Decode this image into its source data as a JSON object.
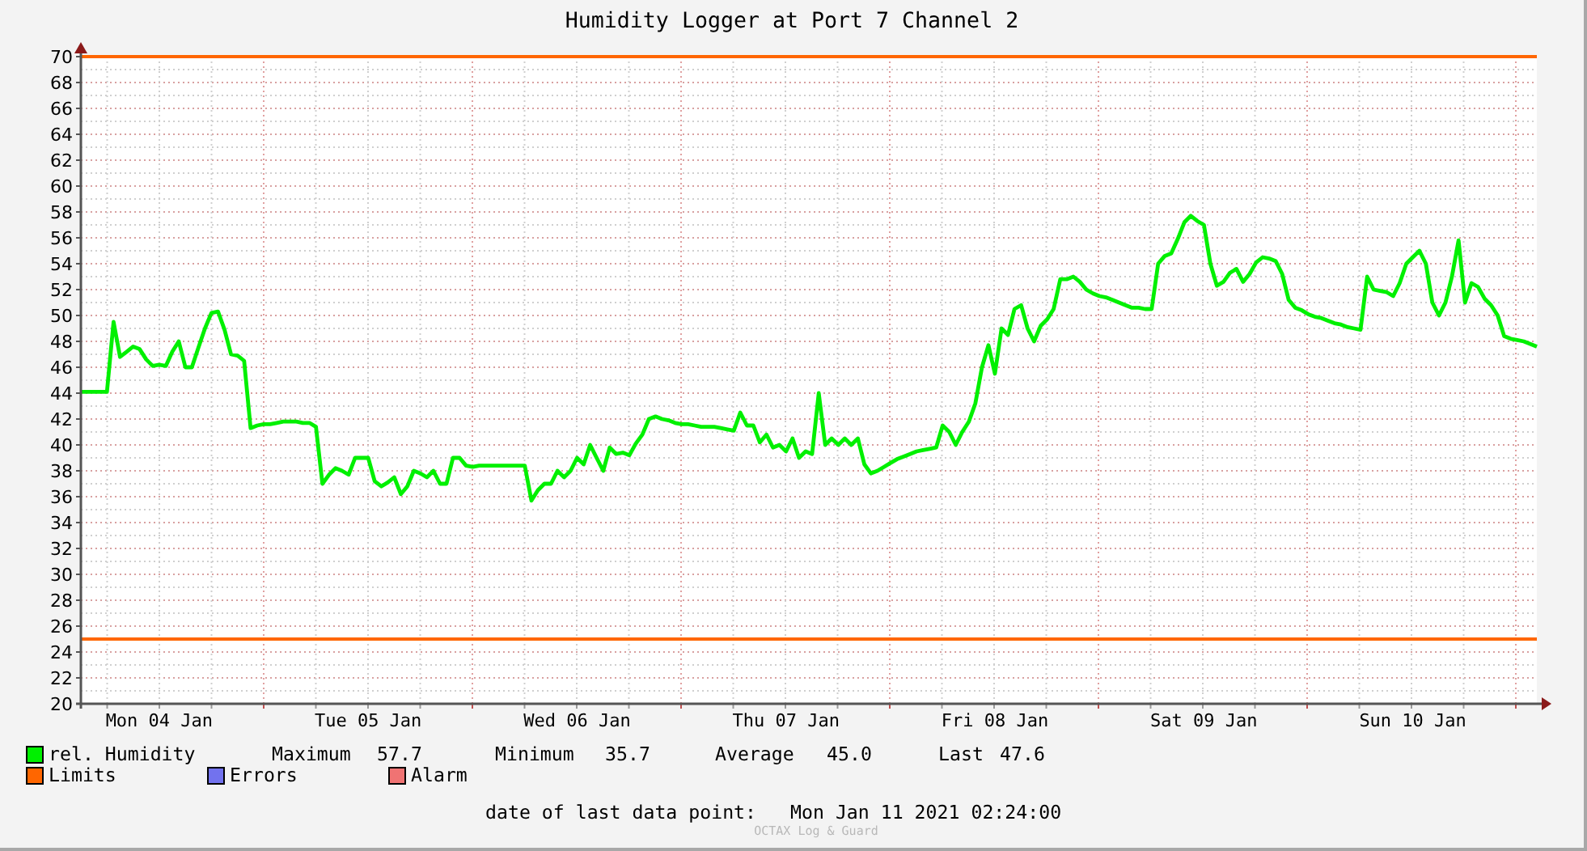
{
  "chart_data": {
    "type": "line",
    "title": "Humidity Logger at Port 7 Channel 2",
    "ylim": [
      20,
      70
    ],
    "yticks": [
      20,
      22,
      24,
      26,
      28,
      30,
      32,
      34,
      36,
      38,
      40,
      42,
      44,
      46,
      48,
      50,
      52,
      54,
      56,
      58,
      60,
      62,
      64,
      66,
      68,
      70
    ],
    "categories": [
      null,
      null,
      null,
      null,
      null,
      null,
      null,
      null,
      null,
      null,
      null,
      null,
      "Mon 04 Jan",
      null,
      null,
      null,
      null,
      null,
      null,
      null,
      null,
      null,
      null,
      null,
      null,
      null,
      null,
      null,
      null,
      null,
      null,
      null,
      null,
      null,
      null,
      null,
      null,
      null,
      null,
      null,
      null,
      null,
      null,
      null,
      "Tue 05 Jan",
      null,
      null,
      null,
      null,
      null,
      null,
      null,
      null,
      null,
      null,
      null,
      null,
      null,
      null,
      null,
      null,
      null,
      null,
      null,
      null,
      null,
      null,
      null,
      null,
      null,
      null,
      null,
      null,
      null,
      null,
      null,
      "Wed 06 Jan",
      null,
      null,
      null,
      null,
      null,
      null,
      null,
      null,
      null,
      null,
      null,
      null,
      null,
      null,
      null,
      null,
      null,
      null,
      null,
      null,
      null,
      null,
      null,
      null,
      null,
      null,
      null,
      null,
      null,
      null,
      null,
      "Thu 07 Jan",
      null,
      null,
      null,
      null,
      null,
      null,
      null,
      null,
      null,
      null,
      null,
      null,
      null,
      null,
      null,
      null,
      null,
      null,
      null,
      null,
      null,
      null,
      null,
      null,
      null,
      null,
      null,
      null,
      null,
      null,
      null,
      "Fri 08 Jan",
      null,
      null,
      null,
      null,
      null,
      null,
      null,
      null,
      null,
      null,
      null,
      null,
      null,
      null,
      null,
      null,
      null,
      null,
      null,
      null,
      null,
      null,
      null,
      null,
      null,
      null,
      null,
      null,
      null,
      null,
      null,
      "Sat 09 Jan",
      null,
      null,
      null,
      null,
      null,
      null,
      null,
      null,
      null,
      null,
      null,
      null,
      null,
      null,
      null,
      null,
      null,
      null,
      null,
      null,
      null,
      null,
      null,
      null,
      null,
      null,
      null,
      null,
      null,
      null,
      null,
      "Sun 10 Jan",
      null,
      null,
      null,
      null,
      null,
      null,
      null,
      null,
      null,
      null,
      null,
      null,
      null,
      null,
      null,
      null,
      null,
      null,
      null
    ],
    "series": [
      {
        "name": "rel. Humidity",
        "color": "#00f000",
        "values": [
          44.1,
          44.1,
          44.1,
          44.1,
          44.1,
          49.5,
          46.8,
          47.2,
          47.6,
          47.4,
          46.6,
          46.1,
          46.2,
          46.1,
          47.2,
          48,
          46,
          46,
          47.5,
          49,
          50.2,
          50.3,
          48.9,
          47,
          46.9,
          46.5,
          41.3,
          41.5,
          41.6,
          41.6,
          41.7,
          41.8,
          41.8,
          41.8,
          41.7,
          41.7,
          41.4,
          37,
          37.7,
          38.2,
          38,
          37.7,
          39,
          39,
          39,
          37.2,
          36.8,
          37.1,
          37.5,
          36.2,
          36.8,
          38,
          37.8,
          37.5,
          38,
          37,
          37,
          39,
          39,
          38.4,
          38.3,
          38.4,
          38.4,
          38.4,
          38.4,
          38.4,
          38.4,
          38.4,
          38.4,
          35.7,
          36.5,
          37,
          37,
          38,
          37.5,
          38,
          39,
          38.5,
          40,
          39,
          38,
          39.8,
          39.3,
          39.4,
          39.2,
          40.1,
          40.8,
          42,
          42.2,
          42,
          41.9,
          41.7,
          41.6,
          41.6,
          41.5,
          41.4,
          41.4,
          41.4,
          41.3,
          41.2,
          41.1,
          42.5,
          41.5,
          41.5,
          40.2,
          40.8,
          39.8,
          40,
          39.5,
          40.5,
          39,
          39.5,
          39.3,
          44,
          40,
          40.5,
          40,
          40.5,
          40,
          40.5,
          38.5,
          37.8,
          38,
          38.3,
          38.6,
          38.9,
          39.1,
          39.3,
          39.5,
          39.6,
          39.7,
          39.8,
          41.5,
          41,
          40,
          41,
          41.8,
          43.2,
          46,
          47.7,
          45.5,
          49,
          48.5,
          50.5,
          50.8,
          49,
          48,
          49.2,
          49.7,
          50.5,
          52.8,
          52.8,
          53,
          52.6,
          52,
          51.7,
          51.5,
          51.4,
          51.2,
          51,
          50.8,
          50.6,
          50.6,
          50.5,
          50.5,
          54,
          54.6,
          54.8,
          55.9,
          57.2,
          57.7,
          57.3,
          57,
          54,
          52.3,
          52.6,
          53.3,
          53.6,
          52.6,
          53.2,
          54.1,
          54.5,
          54.4,
          54.2,
          53.2,
          51.2,
          50.6,
          50.4,
          50.1,
          49.9,
          49.8,
          49.6,
          49.4,
          49.3,
          49.1,
          49,
          48.9,
          53,
          52,
          51.9,
          51.8,
          51.5,
          52.5,
          54,
          54.5,
          55,
          54,
          51,
          50,
          51,
          53,
          55.8,
          51,
          52.5,
          52.2,
          51.3,
          50.8,
          50,
          48.4,
          48.2,
          48.1,
          48,
          47.8,
          47.6
        ]
      }
    ],
    "ref_lines": [
      {
        "axis": "y",
        "value": 70
      },
      {
        "axis": "y",
        "value": 25
      }
    ],
    "grid": true
  },
  "legend": {
    "stats": [
      {
        "label": "Maximum",
        "value": "57.7"
      },
      {
        "label": "Minimum",
        "value": "35.7"
      },
      {
        "label": "Average",
        "value": "45.0"
      },
      {
        "label": "Last",
        "value": "47.6"
      }
    ],
    "items": [
      {
        "label": "Limits",
        "color": "#ff6600"
      },
      {
        "label": "Errors",
        "color": "#7272ee"
      },
      {
        "label": "Alarm",
        "color": "#f07373"
      }
    ]
  },
  "last_data_point": {
    "label": "date of last data point:",
    "value": "Mon Jan 11 2021 02:24:00"
  },
  "watermark": "OCTAX Log & Guard"
}
